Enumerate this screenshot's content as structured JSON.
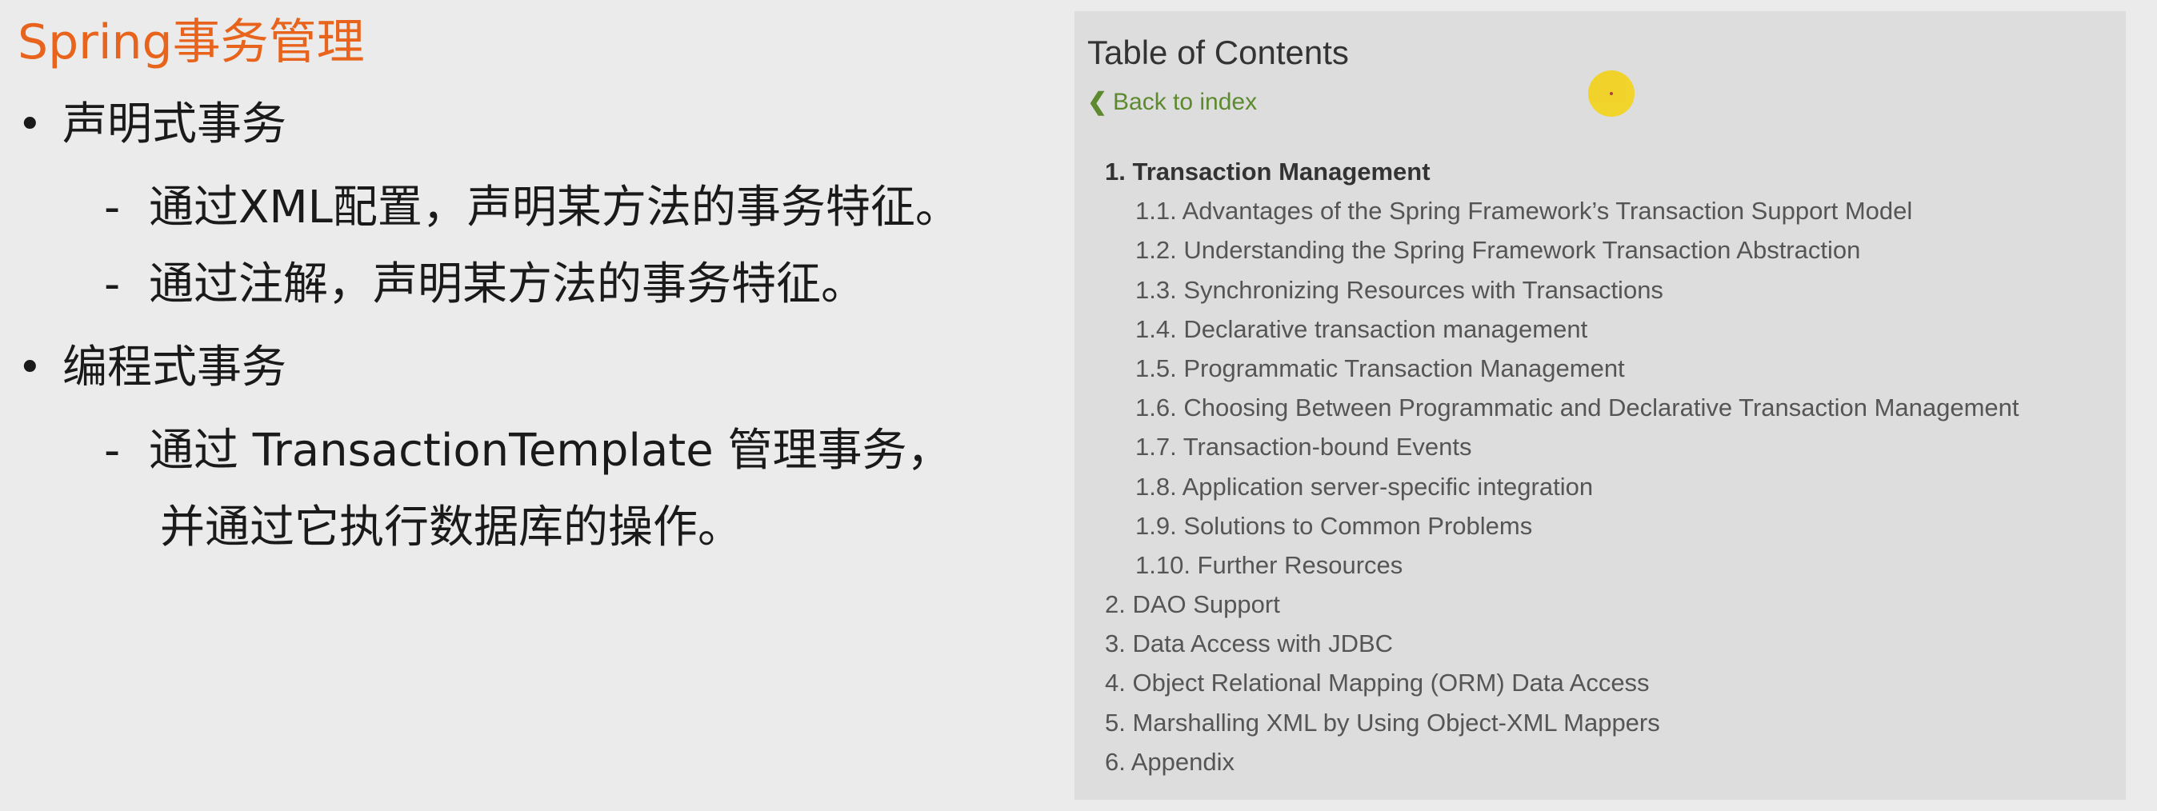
{
  "slide": {
    "title": "Spring事务管理",
    "bullets": [
      {
        "text": "声明式事务",
        "subitems": [
          {
            "lines": [
              "通过XML配置，声明某方法的事务特征。"
            ]
          },
          {
            "lines": [
              "通过注解，声明某方法的事务特征。"
            ]
          }
        ]
      },
      {
        "text": "编程式事务",
        "subitems": [
          {
            "lines": [
              "通过 TransactionTemplate 管理事务，",
              "并通过它执行数据库的操作。"
            ]
          }
        ]
      }
    ],
    "bullet_glyph": "•",
    "dash_glyph": "-"
  },
  "toc": {
    "title": "Table of Contents",
    "back_label": "Back to index",
    "back_icon": "chevron-left-icon",
    "entries": [
      {
        "label": "1. Transaction Management",
        "level": 1,
        "active": true
      },
      {
        "label": "1.1. Advantages of the Spring Framework’s Transaction Support Model",
        "level": 2
      },
      {
        "label": "1.2. Understanding the Spring Framework Transaction Abstraction",
        "level": 2
      },
      {
        "label": "1.3. Synchronizing Resources with Transactions",
        "level": 2
      },
      {
        "label": "1.4. Declarative transaction management",
        "level": 2
      },
      {
        "label": "1.5. Programmatic Transaction Management",
        "level": 2
      },
      {
        "label": "1.6. Choosing Between Programmatic and Declarative Transaction Management",
        "level": 2
      },
      {
        "label": "1.7. Transaction-bound Events",
        "level": 2
      },
      {
        "label": "1.8. Application server-specific integration",
        "level": 2
      },
      {
        "label": "1.9. Solutions to Common Problems",
        "level": 2
      },
      {
        "label": "1.10. Further Resources",
        "level": 2
      },
      {
        "label": "2. DAO Support",
        "level": 1
      },
      {
        "label": "3. Data Access with JDBC",
        "level": 1
      },
      {
        "label": "4. Object Relational Mapping (ORM) Data Access",
        "level": 1
      },
      {
        "label": "5. Marshalling XML by Using Object-XML Mappers",
        "level": 1
      },
      {
        "label": "6. Appendix",
        "level": 1
      }
    ]
  },
  "colors": {
    "title_accent": "#e8641d",
    "link_green": "#5d8a2e",
    "panel_bg": "#dddddd",
    "page_bg": "#ebebeb",
    "cursor_highlight": "#f2d21c"
  }
}
